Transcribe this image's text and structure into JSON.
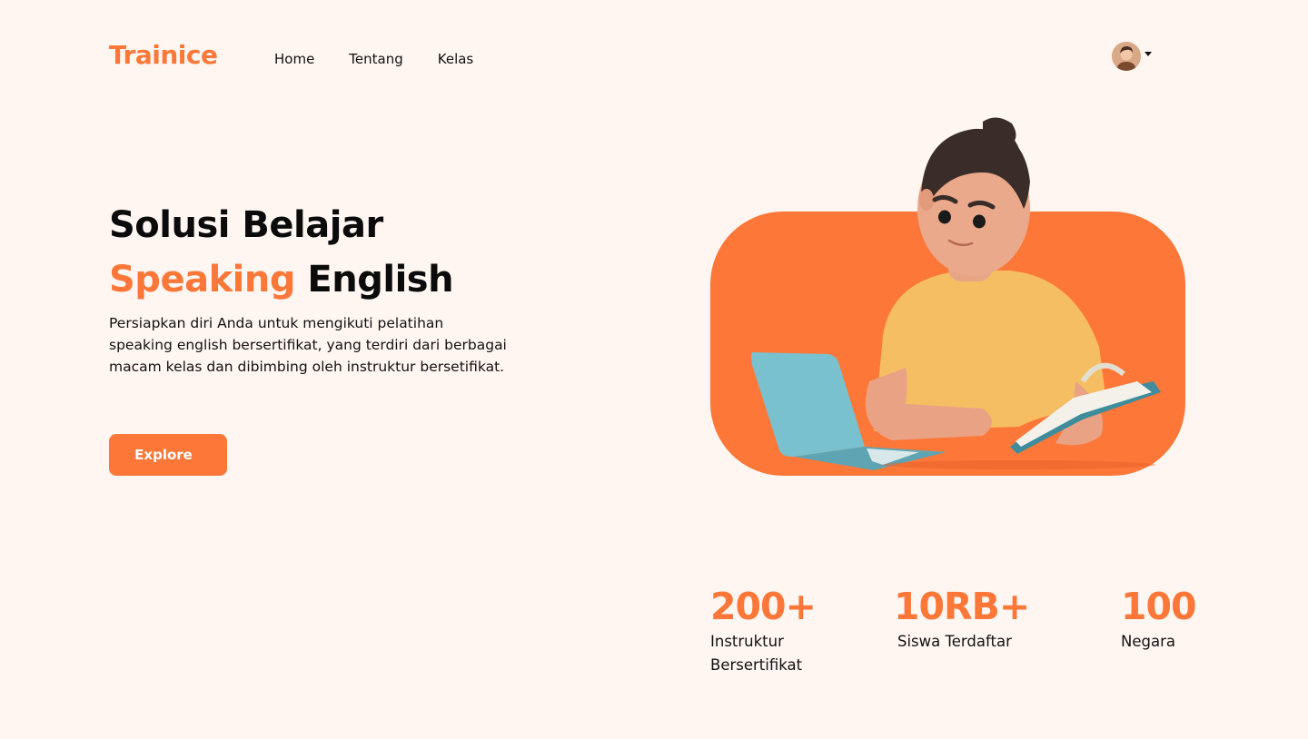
{
  "brand": {
    "name": "Trainice",
    "accent_color": "#FD7738",
    "background_color": "#FFF6F2"
  },
  "nav": {
    "items": [
      {
        "label": "Home"
      },
      {
        "label": "Tentang"
      },
      {
        "label": "Kelas"
      }
    ]
  },
  "profile": {
    "avatar_icon": "user-avatar",
    "dropdown_icon": "caret-down-icon"
  },
  "hero": {
    "title_line1": "Solusi Belajar",
    "title_accent": "Speaking",
    "title_rest": "English",
    "description": "Persiapkan diri Anda untuk mengikuti pelatihan speaking english bersertifikat, yang terdiri dari berbagai macam kelas dan dibimbing oleh instruktur bersetifikat.",
    "cta_label": "Explore",
    "illustration": "student-with-laptop-and-book-illustration"
  },
  "stats": [
    {
      "value": "200+",
      "label_line1": "Instruktur",
      "label_line2": "Bersertifikat"
    },
    {
      "value": "10RB+",
      "label_line1": "Siswa Terdaftar",
      "label_line2": ""
    },
    {
      "value": "100",
      "label_line1": "Negara",
      "label_line2": ""
    }
  ]
}
